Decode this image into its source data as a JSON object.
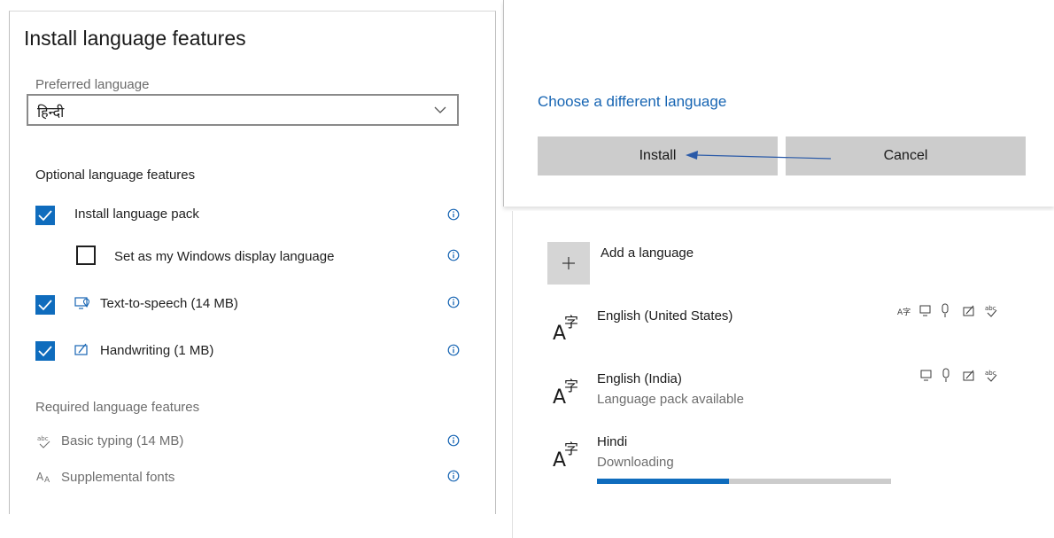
{
  "left_dialog": {
    "title": "Install language features",
    "preferred_label": "Preferred language",
    "preferred_value": "हिन्दी",
    "optional_header": "Optional language features",
    "options": [
      {
        "label": "Install language pack",
        "checked": true
      },
      {
        "label": "Set as my Windows display language",
        "checked": false
      },
      {
        "label": "Text-to-speech (14 MB)",
        "checked": true
      },
      {
        "label": "Handwriting (1 MB)",
        "checked": true
      }
    ],
    "required_header": "Required language features",
    "required": [
      {
        "label": "Basic typing (14 MB)"
      },
      {
        "label": "Supplemental fonts"
      }
    ]
  },
  "right_dialog": {
    "link": "Choose a different language",
    "install_label": "Install",
    "cancel_label": "Cancel"
  },
  "languages_panel": {
    "add_label": "Add a language",
    "languages": [
      {
        "name": "English (United States)",
        "status": ""
      },
      {
        "name": "English (India)",
        "status": "Language pack available"
      },
      {
        "name": "Hindi",
        "status": "Downloading",
        "progress": 0.45
      }
    ]
  },
  "colors": {
    "accent": "#0f6cbd",
    "link": "#1765b3",
    "button": "#cccccc"
  }
}
